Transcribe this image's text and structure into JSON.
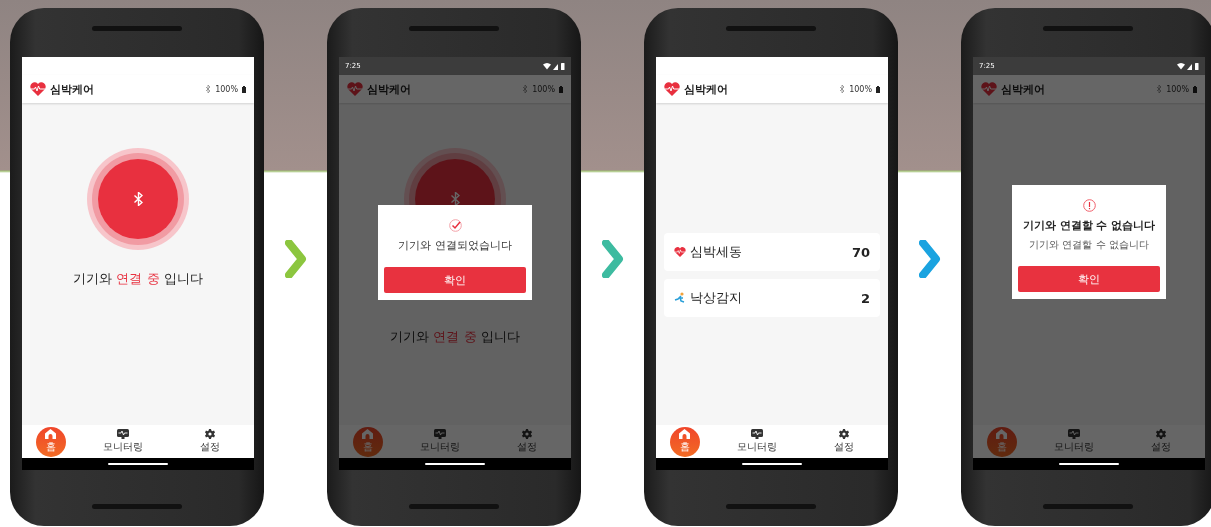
{
  "screens": [
    {
      "kind": "connecting",
      "dimmed": false,
      "header": {
        "title": "심박케어",
        "battery": "100%"
      },
      "message": [
        {
          "text": "기기와 ",
          "highlight": false
        },
        {
          "text": "연결 중",
          "highlight": true
        },
        {
          "text": " 입니다",
          "highlight": false
        }
      ],
      "nav": [
        {
          "label": "홈",
          "kind": "home",
          "selected": true
        },
        {
          "label": "모니터링",
          "kind": "monitor",
          "selected": false
        },
        {
          "label": "설정",
          "kind": "gear",
          "selected": false
        }
      ]
    },
    {
      "kind": "connecting",
      "dimmed": true,
      "status_time": "7:25",
      "header": {
        "title": "심박케어",
        "battery": "100%"
      },
      "message": [
        {
          "text": "기기와 ",
          "highlight": false
        },
        {
          "text": "연결 중",
          "highlight": true
        },
        {
          "text": " 입니다",
          "highlight": false
        }
      ],
      "dialog": {
        "kind": "check",
        "title": "기기와 연결되었습니다",
        "button": "확인"
      },
      "nav": [
        {
          "label": "홈",
          "kind": "home",
          "selected": true
        },
        {
          "label": "모니터링",
          "kind": "monitor",
          "selected": false
        },
        {
          "label": "설정",
          "kind": "gear",
          "selected": false
        }
      ]
    },
    {
      "kind": "dashboard",
      "dimmed": false,
      "header": {
        "title": "심박케어",
        "battery": "100%"
      },
      "cards": [
        {
          "kind": "heart",
          "label": "심박세동",
          "value": "70"
        },
        {
          "kind": "fall",
          "label": "낙상감지",
          "value": "2"
        }
      ],
      "nav": [
        {
          "label": "홈",
          "kind": "home",
          "selected": true
        },
        {
          "label": "모니터링",
          "kind": "monitor",
          "selected": false
        },
        {
          "label": "설정",
          "kind": "gear",
          "selected": false
        }
      ]
    },
    {
      "kind": "blank",
      "dimmed": true,
      "status_time": "7:25",
      "header": {
        "title": "심박케어",
        "battery": "100%"
      },
      "dialog": {
        "kind": "alert",
        "title": "기기와 연결할 수 없습니다",
        "message": "기기와 연결할 수 없습니다",
        "button": "확인"
      },
      "nav": [
        {
          "label": "홈",
          "kind": "home",
          "selected": true
        },
        {
          "label": "모니터링",
          "kind": "monitor",
          "selected": false
        },
        {
          "label": "설정",
          "kind": "gear",
          "selected": false
        }
      ]
    }
  ],
  "arrows": [
    {
      "color": "#8cc63f"
    },
    {
      "color": "#3dbba0"
    },
    {
      "color": "#1aa3e0"
    }
  ]
}
